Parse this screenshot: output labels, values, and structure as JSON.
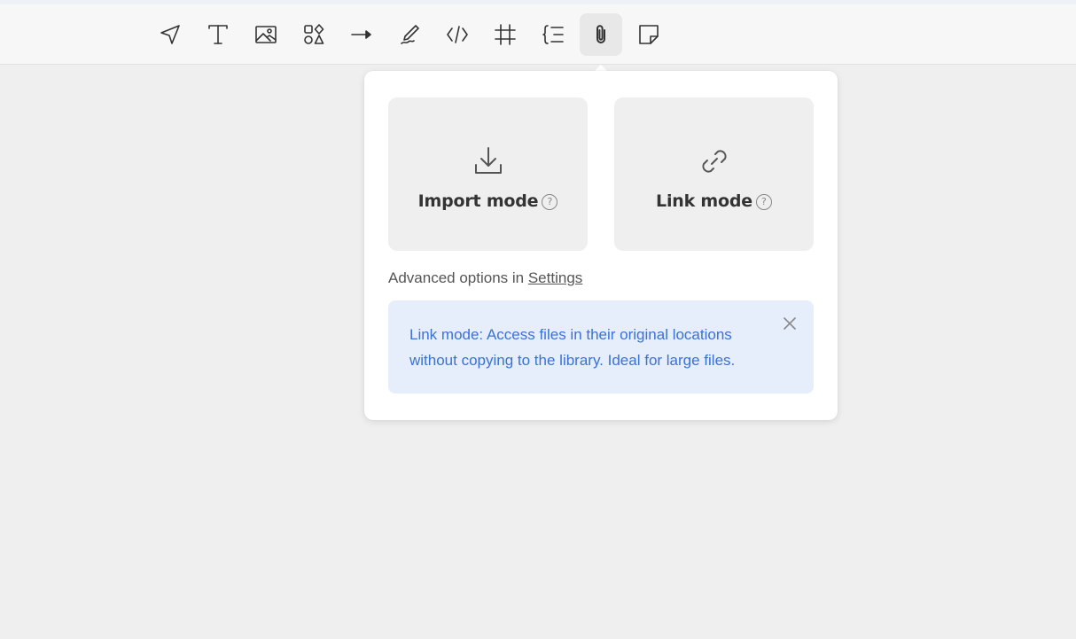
{
  "toolbar": {
    "tools": [
      {
        "name": "select",
        "icon": "navigation-arrow-icon"
      },
      {
        "name": "text",
        "icon": "text-icon"
      },
      {
        "name": "image",
        "icon": "image-icon"
      },
      {
        "name": "shapes",
        "icon": "shapes-icon"
      },
      {
        "name": "connector",
        "icon": "arrow-right-icon"
      },
      {
        "name": "pen",
        "icon": "pen-icon"
      },
      {
        "name": "embed",
        "icon": "code-icon"
      },
      {
        "name": "frame",
        "icon": "hash-frame-icon"
      },
      {
        "name": "outline",
        "icon": "outline-icon"
      },
      {
        "name": "attachment",
        "icon": "paperclip-icon",
        "active": true
      },
      {
        "name": "note",
        "icon": "sticky-note-icon"
      }
    ]
  },
  "attach_popover": {
    "import_mode": {
      "label": "Import mode",
      "icon": "download-icon",
      "help": "?"
    },
    "link_mode": {
      "label": "Link mode",
      "icon": "link-icon",
      "help": "?"
    },
    "advanced_prefix": "Advanced options in",
    "settings_link": "Settings",
    "info": {
      "text": "Link mode: Access files in their original locations without copying to the library. Ideal for large files.",
      "close_icon": "close-icon"
    }
  },
  "colors": {
    "canvas": "#efefef",
    "info_bg": "#e6edfb",
    "info_text": "#3a72d6"
  }
}
